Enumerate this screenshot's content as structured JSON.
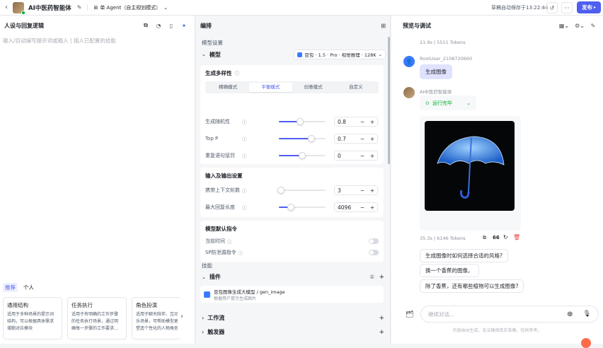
{
  "header": {
    "app_title": "AI中医药智能体",
    "mode_label": "单 Agent（自主规划模式）",
    "save_status": "草稿自动保存于13:22:44",
    "publish_label": "发布"
  },
  "left": {
    "title": "人设与回复逻辑",
    "placeholder": "输入/自动编写提示词或输入 | 插入已配置的技能",
    "tabs": [
      "推荐",
      "个人"
    ],
    "templates": [
      {
        "title": "通用结构",
        "desc1": "适用于多种场景的提示词",
        "desc2": "结构，可以根据具体需求",
        "desc3": "增删对应模块"
      },
      {
        "title": "任务执行",
        "desc1": "适用于有明确的工作步骤",
        "desc2": "的任务执行场景，通过明",
        "desc3": "确每一步骤的工作要求…"
      },
      {
        "title": "角色扮演",
        "desc1": "适用于聊天陪伴、互动",
        "desc2": "乐场景，可帮助模型更",
        "desc3": "塑造个性化的人物角色"
      }
    ]
  },
  "mid": {
    "title": "编排",
    "model_section": "模型设置",
    "model_label": "模型",
    "model_value": "豆包 · 1.5 · Pro · 视觉推理 · 128K",
    "diversity": {
      "title": "生成多样性",
      "tabs": [
        "精确模式",
        "平衡模式",
        "创意模式",
        "自定义"
      ],
      "active_tab": 1,
      "params": [
        {
          "label": "生成随机性",
          "value": "0.8",
          "level": 0.45
        },
        {
          "label": "Top P",
          "value": "0.7",
          "level": 0.7
        },
        {
          "label": "重复语句惩罚",
          "value": "0",
          "level": 0.5
        }
      ]
    },
    "io": {
      "title": "输入及输出设置",
      "params": [
        {
          "label": "携带上下文轮数",
          "value": "3",
          "level": 0.05
        },
        {
          "label": "最大回复长度",
          "value": "4096",
          "level": 0.25
        }
      ]
    },
    "sys": {
      "title": "模型默认指令",
      "items": [
        "当前时间",
        "SP防泄漏指令"
      ]
    },
    "skills": {
      "title": "技能",
      "plugin_label": "插件",
      "plugin_count": "①",
      "plugin_name": "豆包图像生成大模型 / gen_image",
      "plugin_desc": "根据用户提示生成图片",
      "workflow_label": "工作流",
      "trigger_label": "触发器"
    }
  },
  "right": {
    "title": "预览与调试",
    "stats1": "21.9s | 5511 Tokens",
    "user_name": "RootUser_2108720660",
    "user_msg": "生成图像",
    "bot_name": "AI中医药智能体",
    "run_status": "运行完毕",
    "stats2": "35.3s | 6146 Tokens",
    "suggestions": [
      "生成图像时如何选择合适的风格?",
      "换一个香蕉的图像。",
      "除了香蕉，还有哪些植物可以生成图像?"
    ],
    "input_placeholder": "继续对话...",
    "disclaimer": "内容由AI生成，无法确保真实准确，仅供参考。"
  },
  "colors": {
    "accent": "#4e5ef0",
    "success": "#00b42a",
    "danger": "#f53f3f"
  }
}
